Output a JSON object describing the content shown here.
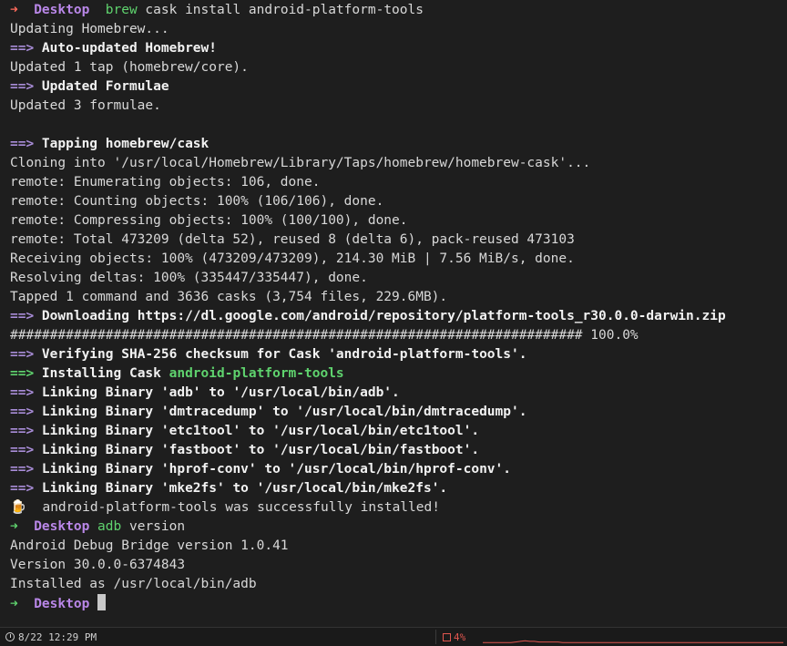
{
  "terminal": {
    "lines": [
      [
        {
          "t": "➜  ",
          "c": "c-prompt-arrow"
        },
        {
          "t": "Desktop",
          "c": "c-dir"
        },
        {
          "t": "  ",
          "c": "c-white"
        },
        {
          "t": "brew",
          "c": "c-cmd"
        },
        {
          "t": " cask install android-platform-tools",
          "c": "c-white"
        }
      ],
      [
        {
          "t": "Updating Homebrew...",
          "c": "c-white"
        }
      ],
      [
        {
          "t": "==>",
          "c": "c-arrow"
        },
        {
          "t": " Auto-updated Homebrew!",
          "c": "c-bold"
        }
      ],
      [
        {
          "t": "Updated 1 tap (homebrew/core).",
          "c": "c-white"
        }
      ],
      [
        {
          "t": "==>",
          "c": "c-arrow"
        },
        {
          "t": " Updated Formulae",
          "c": "c-bold"
        }
      ],
      [
        {
          "t": "Updated 3 formulae.",
          "c": "c-white"
        }
      ],
      [
        {
          "t": "",
          "c": "c-white"
        }
      ],
      [
        {
          "t": "==>",
          "c": "c-arrow"
        },
        {
          "t": " Tapping homebrew/cask",
          "c": "c-bold"
        }
      ],
      [
        {
          "t": "Cloning into '/usr/local/Homebrew/Library/Taps/homebrew/homebrew-cask'...",
          "c": "c-white"
        }
      ],
      [
        {
          "t": "remote: Enumerating objects: 106, done.",
          "c": "c-white"
        }
      ],
      [
        {
          "t": "remote: Counting objects: 100% (106/106), done.",
          "c": "c-white"
        }
      ],
      [
        {
          "t": "remote: Compressing objects: 100% (100/100), done.",
          "c": "c-white"
        }
      ],
      [
        {
          "t": "remote: Total 473209 (delta 52), reused 8 (delta 6), pack-reused 473103",
          "c": "c-white"
        }
      ],
      [
        {
          "t": "Receiving objects: 100% (473209/473209), 214.30 MiB | 7.56 MiB/s, done.",
          "c": "c-white"
        }
      ],
      [
        {
          "t": "Resolving deltas: 100% (335447/335447), done.",
          "c": "c-white"
        }
      ],
      [
        {
          "t": "Tapped 1 command and 3636 casks (3,754 files, 229.6MB).",
          "c": "c-white"
        }
      ],
      [
        {
          "t": "==>",
          "c": "c-arrow"
        },
        {
          "t": " Downloading https://dl.google.com/android/repository/platform-tools_r30.0.0-darwin.zip",
          "c": "c-bold"
        }
      ],
      [
        {
          "t": "######################################################################## 100.0%",
          "c": "c-white"
        }
      ],
      [
        {
          "t": "==>",
          "c": "c-arrow"
        },
        {
          "t": " Verifying SHA-256 checksum for Cask 'android-platform-tools'.",
          "c": "c-bold"
        }
      ],
      [
        {
          "t": "==>",
          "c": "c-green-arrow"
        },
        {
          "t": " Installing Cask ",
          "c": "c-bold"
        },
        {
          "t": "android-platform-tools",
          "c": "c-pkg"
        }
      ],
      [
        {
          "t": "==>",
          "c": "c-arrow"
        },
        {
          "t": " Linking Binary 'adb' to '/usr/local/bin/adb'.",
          "c": "c-bold"
        }
      ],
      [
        {
          "t": "==>",
          "c": "c-arrow"
        },
        {
          "t": " Linking Binary 'dmtracedump' to '/usr/local/bin/dmtracedump'.",
          "c": "c-bold"
        }
      ],
      [
        {
          "t": "==>",
          "c": "c-arrow"
        },
        {
          "t": " Linking Binary 'etc1tool' to '/usr/local/bin/etc1tool'.",
          "c": "c-bold"
        }
      ],
      [
        {
          "t": "==>",
          "c": "c-arrow"
        },
        {
          "t": " Linking Binary 'fastboot' to '/usr/local/bin/fastboot'.",
          "c": "c-bold"
        }
      ],
      [
        {
          "t": "==>",
          "c": "c-arrow"
        },
        {
          "t": " Linking Binary 'hprof-conv' to '/usr/local/bin/hprof-conv'.",
          "c": "c-bold"
        }
      ],
      [
        {
          "t": "==>",
          "c": "c-arrow"
        },
        {
          "t": " Linking Binary 'mke2fs' to '/usr/local/bin/mke2fs'.",
          "c": "c-bold"
        }
      ],
      [
        {
          "t": "🍺",
          "c": "emoji"
        },
        {
          "t": "  android-platform-tools was successfully installed!",
          "c": "c-white"
        }
      ],
      [
        {
          "t": "➜  ",
          "c": "c-ok-arrow"
        },
        {
          "t": "Desktop",
          "c": "c-dir"
        },
        {
          "t": " ",
          "c": "c-white"
        },
        {
          "t": "adb",
          "c": "c-cmd"
        },
        {
          "t": " version",
          "c": "c-white"
        }
      ],
      [
        {
          "t": "Android Debug Bridge version 1.0.41",
          "c": "c-white"
        }
      ],
      [
        {
          "t": "Version 30.0.0-6374843",
          "c": "c-white"
        }
      ],
      [
        {
          "t": "Installed as /usr/local/bin/adb",
          "c": "c-white"
        }
      ],
      [
        {
          "t": "➜  ",
          "c": "c-ok-arrow"
        },
        {
          "t": "Desktop",
          "c": "c-dir"
        },
        {
          "t": " ",
          "c": "c-white"
        }
      ]
    ],
    "cursor_on_last_line": true
  },
  "statusbar": {
    "icon": "clock-icon",
    "datetime": "8/22 12:29 PM",
    "cpu_icon": "cpu-icon",
    "cpu_percent": "4%",
    "cpu_color": "#e0564f",
    "cpu_history": [
      1,
      1,
      1,
      1,
      1,
      1,
      1,
      2,
      3,
      4,
      3,
      3,
      2,
      2,
      2,
      2,
      2,
      1,
      1,
      1,
      1,
      1,
      1,
      1,
      1,
      1,
      1,
      1,
      1,
      1,
      1,
      1,
      1,
      1,
      1,
      1,
      1,
      1,
      1,
      1,
      1,
      1,
      1,
      1,
      1,
      1,
      1,
      1,
      1,
      1,
      1,
      1,
      1,
      1,
      1,
      1,
      1,
      1,
      1,
      1,
      1,
      1,
      1,
      1,
      1
    ]
  }
}
